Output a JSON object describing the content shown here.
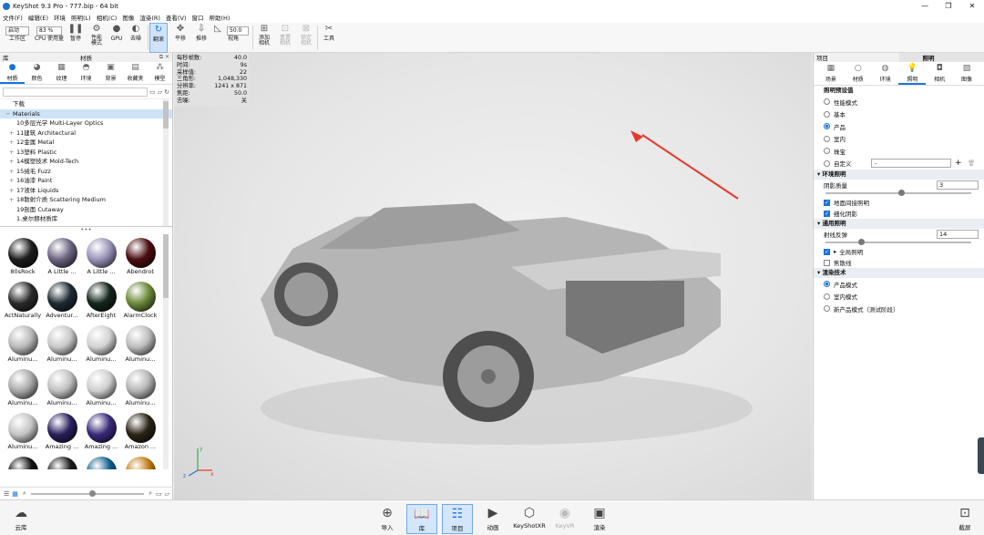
{
  "title": "KeyShot 9.3 Pro  - 777.bip  - 64 bit",
  "window_controls": [
    "—",
    "❐",
    "✕"
  ],
  "menu": [
    "文件(F)",
    "编辑(E)",
    "环境",
    "照明(L)",
    "相机(C)",
    "图像",
    "渲染(R)",
    "查看(V)",
    "窗口",
    "帮助(H)"
  ],
  "toolbar": {
    "workspace_value": "启动",
    "workspace_label": "工作区",
    "cpu_value": "83 %",
    "cpu_label": "CPU 使用量",
    "pause_label": "暂停",
    "perf_label": "性能\n模式",
    "gpu_label": "GPU",
    "denoise_label": "去噪",
    "refresh_label": "翻滚",
    "pan_label": "平移",
    "dolly_label": "推移",
    "fov_value": "50.0",
    "fov_label": "视角",
    "add_camera_label": "添加\n相机",
    "reset_camera_label": "重置\n相机",
    "lock_camera_label": "锁定\n相机",
    "tools_label": "工具"
  },
  "left": {
    "header_left": "库",
    "header_center": "材质",
    "tabs": [
      "材质",
      "颜色",
      "纹理",
      "环境",
      "背景",
      "收藏夹",
      "模型"
    ],
    "tree": [
      {
        "label": "下载",
        "pm": "",
        "level": 0,
        "sel": false
      },
      {
        "label": "Materials",
        "pm": "−",
        "level": 0,
        "sel": true
      },
      {
        "label": "10多层光学 Multi-Layer Optics",
        "pm": "",
        "level": 1,
        "sel": false
      },
      {
        "label": "11建筑 Architectural",
        "pm": "+",
        "level": 1,
        "sel": false
      },
      {
        "label": "12金属 Metal",
        "pm": "+",
        "level": 1,
        "sel": false
      },
      {
        "label": "13塑料 Plastic",
        "pm": "+",
        "level": 1,
        "sel": false
      },
      {
        "label": "14模塑技术 Mold-Tech",
        "pm": "+",
        "level": 1,
        "sel": false
      },
      {
        "label": "15绒毛 Fuzz",
        "pm": "+",
        "level": 1,
        "sel": false
      },
      {
        "label": "16油漆 Paint",
        "pm": "+",
        "level": 1,
        "sel": false
      },
      {
        "label": "17液体 Liquids",
        "pm": "+",
        "level": 1,
        "sel": false
      },
      {
        "label": "18散射介质 Scattering Medium",
        "pm": "+",
        "level": 1,
        "sel": false
      },
      {
        "label": "19剖面 Cutaway",
        "pm": "",
        "level": 1,
        "sel": false
      },
      {
        "label": "1.桌尔赫材质库",
        "pm": "",
        "level": 1,
        "sel": false
      }
    ],
    "materials": [
      {
        "name": "80sRock",
        "color": "#1d1d1d"
      },
      {
        "name": "A Little ...",
        "color": "#6b6480"
      },
      {
        "name": "A Little ...",
        "color": "#9a93b8"
      },
      {
        "name": "Abendrot",
        "color": "#4a0d10"
      },
      {
        "name": "ActNaturally",
        "color": "#2b2b2b"
      },
      {
        "name": "Adventur...",
        "color": "#1e2b33"
      },
      {
        "name": "AfterEight",
        "color": "#14261c"
      },
      {
        "name": "AlarmClock",
        "color": "#6b8a3a"
      },
      {
        "name": "Aluminu...",
        "color": "#b9b9b9"
      },
      {
        "name": "Aluminu...",
        "color": "#c8c8c8"
      },
      {
        "name": "Aluminu...",
        "color": "#d2d2d2"
      },
      {
        "name": "Aluminu...",
        "color": "#bdbdbd"
      },
      {
        "name": "Aluminu...",
        "color": "#a9a9a9"
      },
      {
        "name": "Aluminu...",
        "color": "#c1c1c1"
      },
      {
        "name": "Aluminu...",
        "color": "#cfcfcf"
      },
      {
        "name": "Aluminu...",
        "color": "#b5b5b5"
      },
      {
        "name": "Aluminu...",
        "color": "#c4c4c4"
      },
      {
        "name": "Amazing ...",
        "color": "#2a1f5c"
      },
      {
        "name": "Amazing ...",
        "color": "#3a2a7a"
      },
      {
        "name": "Amazon ...",
        "color": "#2b2416"
      },
      {
        "name": "",
        "color": "#111"
      },
      {
        "name": "",
        "color": "#1a1a1a"
      },
      {
        "name": "",
        "color": "#0f5f8f"
      },
      {
        "name": "",
        "color": "#c17a12"
      }
    ]
  },
  "stats": [
    {
      "k": "每秒帧数:",
      "v": "40.0"
    },
    {
      "k": "时间:",
      "v": "9s"
    },
    {
      "k": "采样值:",
      "v": "22"
    },
    {
      "k": "三角形:",
      "v": "1,048,330"
    },
    {
      "k": "分辨率:",
      "v": "1241 x 871"
    },
    {
      "k": "焦距:",
      "v": "50.0"
    },
    {
      "k": "去噪:",
      "v": "关"
    }
  ],
  "right": {
    "header_left": "项目",
    "header_center": "照明",
    "tabs": [
      "场景",
      "材质",
      "环境",
      "照明",
      "相机",
      "图像"
    ],
    "preset_title": "照明预设值",
    "presets": [
      {
        "label": "性能模式",
        "on": false
      },
      {
        "label": "基本",
        "on": false
      },
      {
        "label": "产品",
        "on": true
      },
      {
        "label": "室内",
        "on": false
      },
      {
        "label": "珠宝",
        "on": false
      },
      {
        "label": "自定义",
        "on": false
      }
    ],
    "custom_value": "-",
    "env_title": "环境照明",
    "shadow_label": "阴影质量",
    "shadow_value": "3",
    "env_checks": [
      {
        "label": "地面间接照明",
        "on": true
      },
      {
        "label": "细化阴影",
        "on": true
      }
    ],
    "general_title": "通用照明",
    "ray_label": "射线反弹",
    "ray_value": "14",
    "gi_label": "全局照明",
    "gi_on": true,
    "caustic_label": "焦散线",
    "caustic_on": false,
    "render_title": "渲染技术",
    "render_modes": [
      {
        "label": "产品模式",
        "on": true
      },
      {
        "label": "室内模式",
        "on": false
      },
      {
        "label": "新产品模式（测试阶段）",
        "on": false
      }
    ]
  },
  "bottom": {
    "cloud": "云库",
    "import": "导入",
    "library": "库",
    "project": "项目",
    "animation": "动画",
    "keyshotxr": "KeyShotXR",
    "keyvr": "KeyVR",
    "render": "渲染",
    "screenshot": "截屏"
  }
}
